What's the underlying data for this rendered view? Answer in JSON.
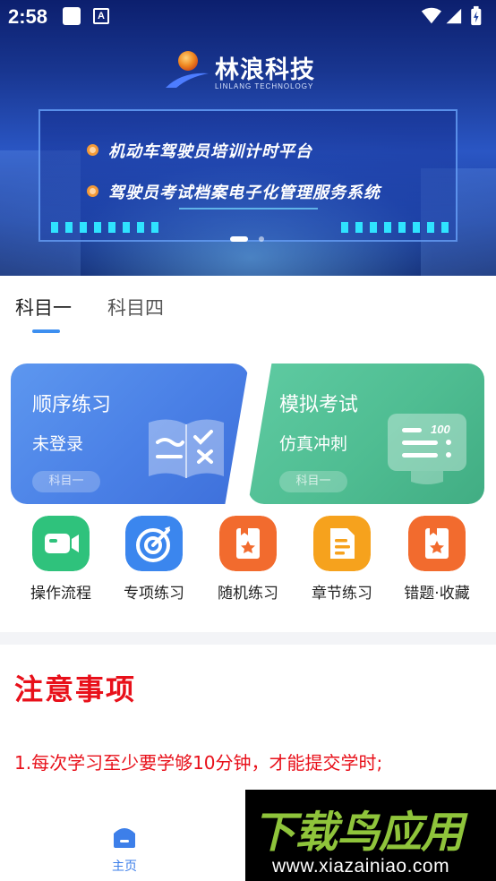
{
  "status_bar": {
    "time": "2:58",
    "a_badge": "A"
  },
  "banner": {
    "logo_text": "林浪科技",
    "logo_subtitle": "LINLANG TECHNOLOGY",
    "line1": "机动车驾驶员培训计时平台",
    "line2": "驾驶员考试档案电子化管理服务系统"
  },
  "tabs": [
    {
      "label": "科目一",
      "active": true
    },
    {
      "label": "科目四",
      "active": false
    }
  ],
  "cards": {
    "sequential": {
      "title": "顺序练习",
      "subtitle": "未登录",
      "tag": "科目一",
      "color": "#4a80e6"
    },
    "mock_exam": {
      "title": "模拟考试",
      "subtitle": "仿真冲刺",
      "tag": "科目一",
      "color": "#4fbd92",
      "icon_text": "100"
    }
  },
  "grid": [
    {
      "label": "操作流程",
      "icon": "video-icon",
      "color": "#2fc27c"
    },
    {
      "label": "专项练习",
      "icon": "target-icon",
      "color": "#3b86ee"
    },
    {
      "label": "随机练习",
      "icon": "star-card-icon",
      "color": "#f26b2e"
    },
    {
      "label": "章节练习",
      "icon": "document-icon",
      "color": "#f6a21d"
    },
    {
      "label": "错题·收藏",
      "icon": "star-card-icon",
      "color": "#f26b2e"
    }
  ],
  "notice": {
    "title": "注意事项",
    "items": [
      "1.每次学习至少要学够10分钟，才能提交学时;"
    ]
  },
  "bottom_nav": {
    "home_label": "主页",
    "accent": "#3d7fe9"
  },
  "watermark": {
    "big": "下载鸟应用",
    "url": "www.xiazainiao.com"
  }
}
